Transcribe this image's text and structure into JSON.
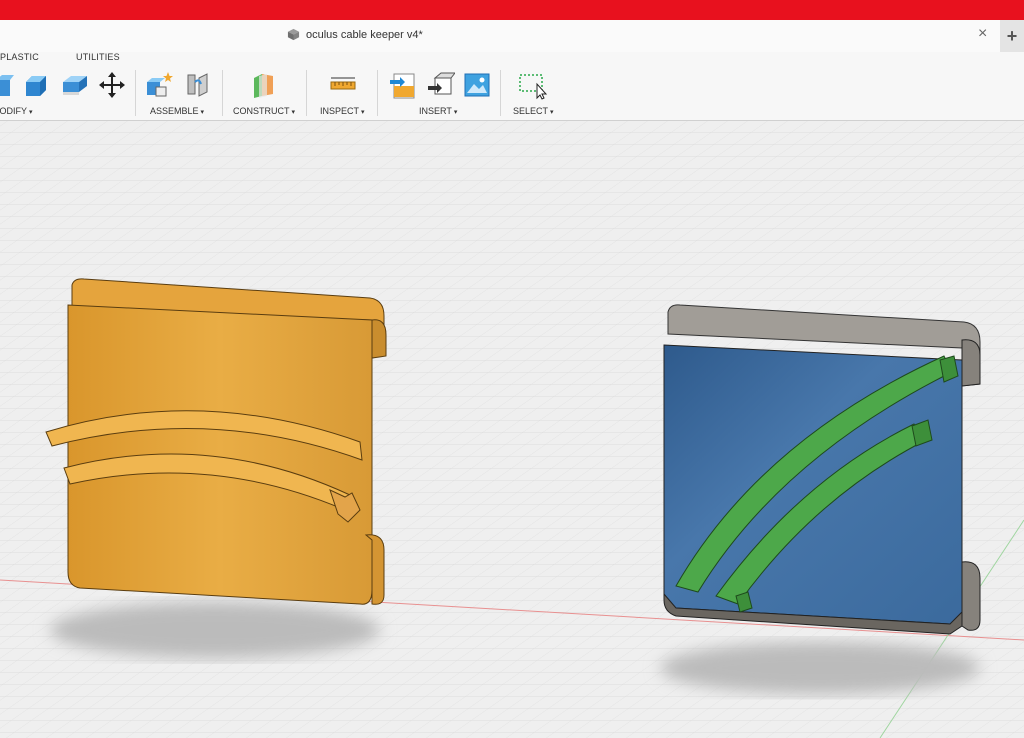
{
  "window": {
    "doc_title": "oculus cable keeper v4*",
    "close_glyph": "×",
    "new_tab_glyph": "+"
  },
  "toolbar": {
    "tabs": [
      "PLASTIC",
      "UTILITIES"
    ],
    "groups": {
      "modify": "MODIFY",
      "assemble": "ASSEMBLE",
      "construct": "CONSTRUCT",
      "inspect": "INSPECT",
      "insert": "INSERT",
      "select": "SELECT"
    },
    "caret": "▾"
  },
  "icons": [
    "cube-icon",
    "press-pull-icon",
    "fillet-icon",
    "move-icon",
    "new-component-icon",
    "joint-icon",
    "plane-icon",
    "measure-icon",
    "insert-svg-icon",
    "insert-mesh-icon",
    "canvas-image-icon",
    "window-select-icon"
  ],
  "colors": {
    "title_bar": "#e8111e",
    "part_orange": "#e8a93a",
    "face_blue": "#3d6b9e",
    "rail_green": "#4da84a",
    "frame_gray": "#8e8a85"
  }
}
